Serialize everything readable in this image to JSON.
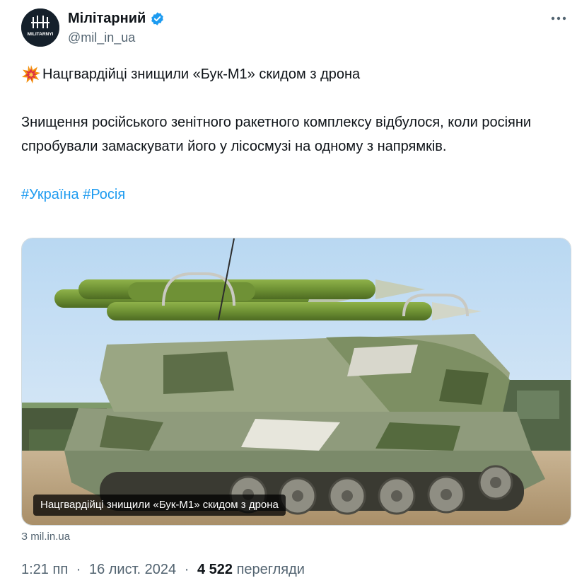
{
  "author": {
    "display_name": "Мілітарний",
    "handle": "@mil_in_ua",
    "avatar_text": "MILITARNYI",
    "verified": true
  },
  "post": {
    "headline": "Нацгвардійці знищили «Бук-М1» скидом з дрона",
    "body": "Знищення російського зенітного ракетного комплексу відбулося, коли росіяни спробували замаскувати його у лісосмузі на одному з напрямків.",
    "hashtags": [
      "#Україна",
      "#Росія"
    ]
  },
  "media": {
    "caption": "Нацгвардійці знищили «Бук-М1» скидом з дрона",
    "link_source": "З mil.in.ua"
  },
  "meta": {
    "time": "1:21 пп",
    "date": "16 лист. 2024",
    "separator": "·",
    "views_count": "4 522",
    "views_label": "перегляди"
  },
  "colors": {
    "text": "#0f1419",
    "secondary": "#536471",
    "link": "#1d9bf0",
    "border": "#cfd9de",
    "verified": "#1d9bf0"
  },
  "icons": {
    "verified": "verified-badge-icon",
    "more": "more-dots-icon",
    "emoji": "collision-emoji-icon"
  }
}
